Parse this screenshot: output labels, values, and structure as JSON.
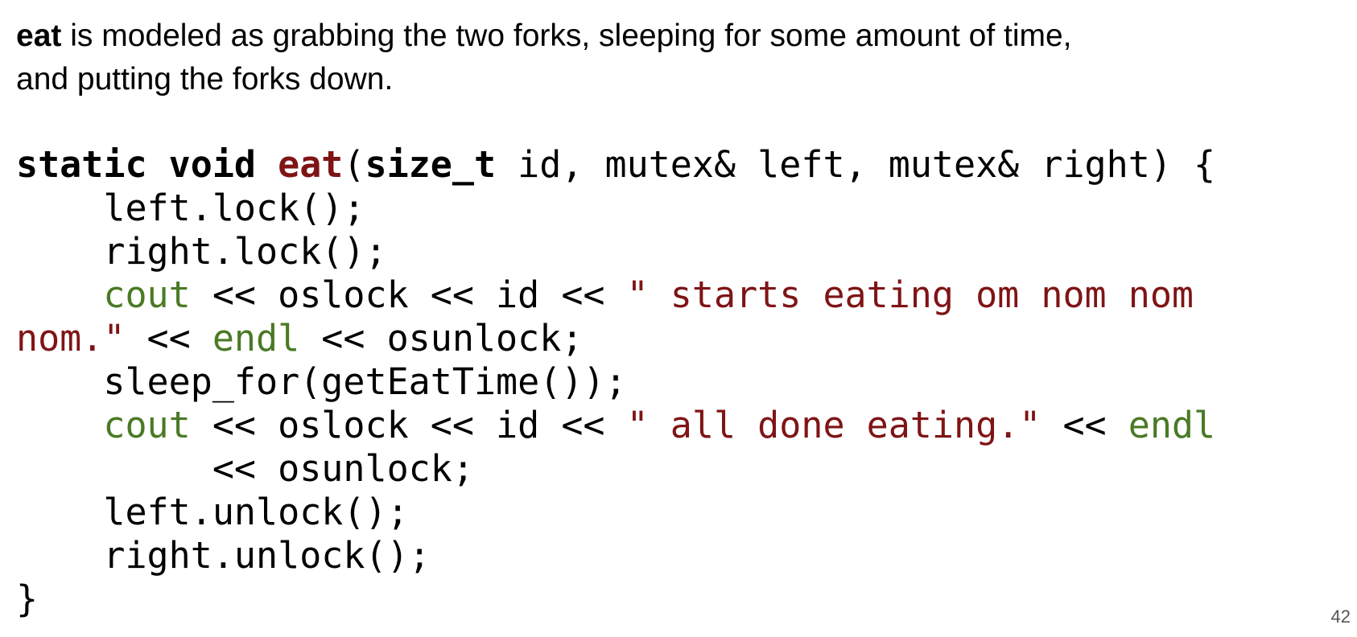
{
  "intro": {
    "bold": "eat",
    "line1": " is modeled as grabbing the two forks, sleeping for some amount of time,",
    "line2": "and putting the forks down."
  },
  "code": {
    "sig_static": "static",
    "sig_void": "void",
    "sig_fn": "eat",
    "sig_open": "(",
    "sig_type": "size_t",
    "sig_rest": " id, mutex& left, mutex& right) {",
    "l2": "    left.lock();",
    "l3": "    right.lock();",
    "l4_indent": "    ",
    "l4_cout": "cout",
    "l4_mid": " << oslock << id << ",
    "l4_str": "\" starts eating om nom nom",
    "l5_str": "nom.\"",
    "l5_mid": " << ",
    "l5_endl": "endl",
    "l5_rest": " << osunlock;",
    "l6": "    sleep_for(getEatTime());",
    "l7_indent": "    ",
    "l7_cout": "cout",
    "l7_mid": " << oslock << id << ",
    "l7_str": "\" all done eating.\"",
    "l7_mid2": " << ",
    "l7_endl": "endl",
    "l8": "         << osunlock;",
    "l9": "    left.unlock();",
    "l10": "    right.unlock();",
    "l11": "}"
  },
  "slide": {
    "page_number": "42"
  },
  "colors": {
    "function_and_string": "#7f1416",
    "stream_keywords": "#4a7a25",
    "text": "#000000"
  }
}
